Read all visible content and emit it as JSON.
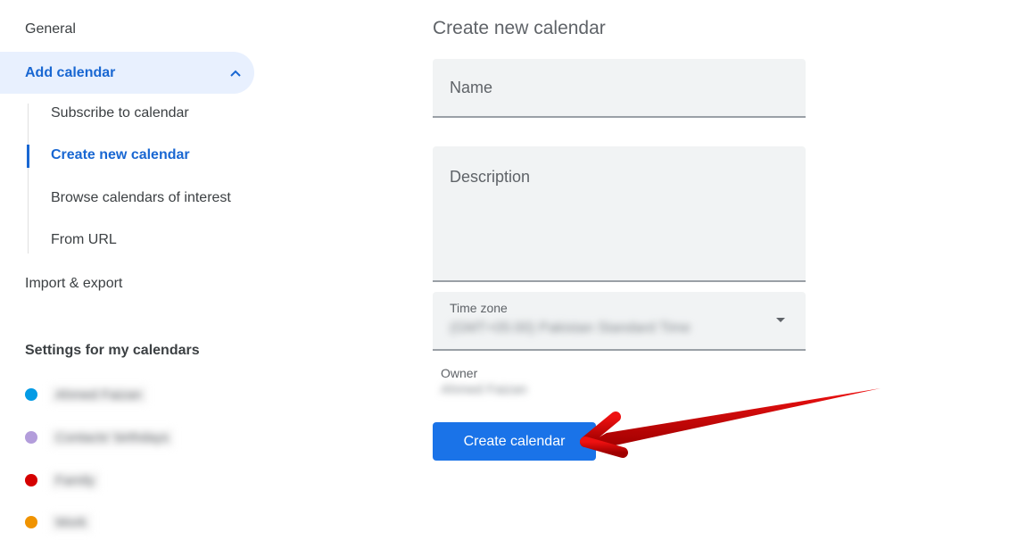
{
  "sidebar": {
    "general": "General",
    "add_calendar": "Add calendar",
    "add_calendar_subitems": [
      {
        "label": "Subscribe to calendar",
        "active": false
      },
      {
        "label": "Create new calendar",
        "active": true
      },
      {
        "label": "Browse calendars of interest",
        "active": false
      },
      {
        "label": "From URL",
        "active": false
      }
    ],
    "import_export": "Import & export",
    "settings_section": "Settings for my calendars",
    "calendars": [
      {
        "name": "Ahmed Faizan",
        "color": "#039be5"
      },
      {
        "name": "Contacts' birthdays",
        "color": "#b39ddb"
      },
      {
        "name": "Family",
        "color": "#d50000"
      },
      {
        "name": "Work",
        "color": "#f09300"
      }
    ]
  },
  "main": {
    "title": "Create new calendar",
    "name_placeholder": "Name",
    "description_placeholder": "Description",
    "timezone_label": "Time zone",
    "timezone_value": "(GMT+05:00) Pakistan Standard Time",
    "owner_label": "Owner",
    "owner_value": "Ahmed Faizan",
    "create_button": "Create calendar"
  },
  "annotation": {
    "arrow_color": "#d00000"
  }
}
